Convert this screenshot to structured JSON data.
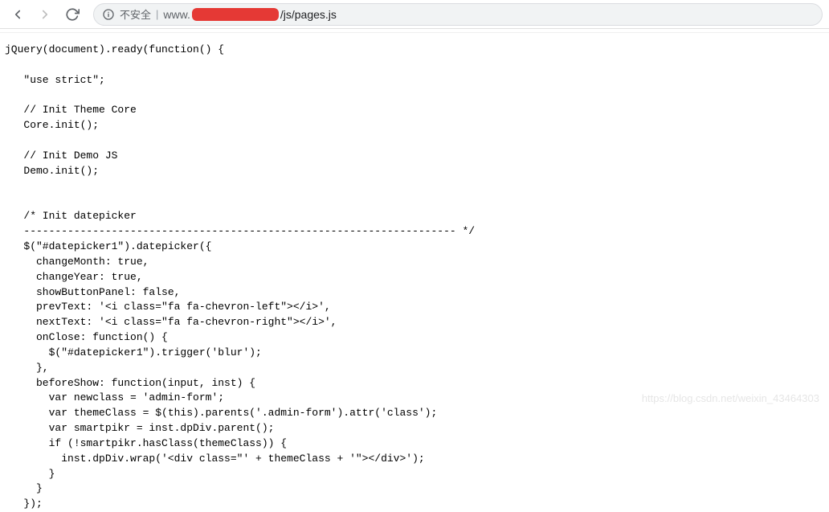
{
  "toolbar": {
    "security_label": "不安全",
    "divider": "|",
    "url_prefix": "www.",
    "url_suffix": "/js/pages.js"
  },
  "code": "jQuery(document).ready(function() {\n\n   \"use strict\";\n\n   // Init Theme Core\n   Core.init();\n\n   // Init Demo JS\n   Demo.init();\n\n\n   /* Init datepicker\n   --------------------------------------------------------------------- */\n   $(\"#datepicker1\").datepicker({\n     changeMonth: true,\n     changeYear: true,\n     showButtonPanel: false,\n     prevText: '<i class=\"fa fa-chevron-left\"></i>',\n     nextText: '<i class=\"fa fa-chevron-right\"></i>',\n     onClose: function() {\n       $(\"#datepicker1\").trigger('blur');\n     },\n     beforeShow: function(input, inst) {\n       var newclass = 'admin-form';\n       var themeClass = $(this).parents('.admin-form').attr('class');\n       var smartpikr = inst.dpDiv.parent();\n       if (!smartpikr.hasClass(themeClass)) {\n         inst.dpDiv.wrap('<div class=\"' + themeClass + '\"></div>');\n       }\n     }\n   });",
  "watermark": "https://blog.csdn.net/weixin_43464303"
}
